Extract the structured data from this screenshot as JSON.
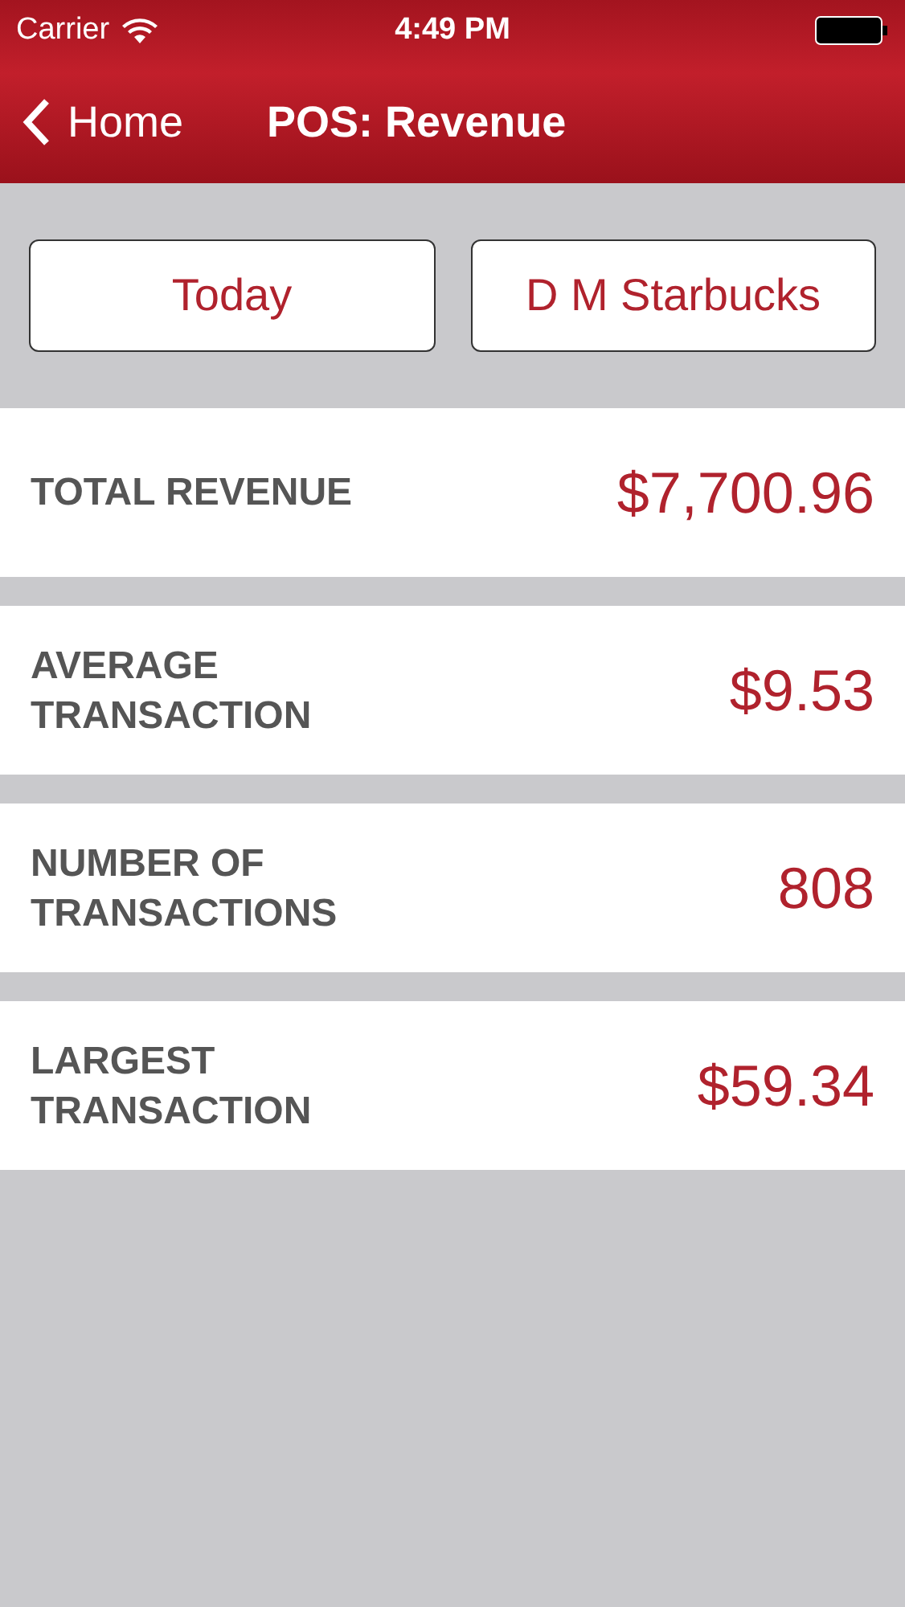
{
  "status_bar": {
    "carrier": "Carrier",
    "time": "4:49 PM"
  },
  "nav": {
    "back_label": "Home",
    "title": "POS: Revenue"
  },
  "filters": [
    {
      "label": "Today"
    },
    {
      "label": "D M Starbucks"
    }
  ],
  "metrics": [
    {
      "label": "TOTAL REVENUE",
      "value": "$7,700.96"
    },
    {
      "label": "AVERAGE\nTRANSACTION",
      "value": "$9.53"
    },
    {
      "label": "NUMBER OF\nTRANSACTIONS",
      "value": "808"
    },
    {
      "label": "LARGEST\nTRANSACTION",
      "value": "$59.34"
    }
  ]
}
